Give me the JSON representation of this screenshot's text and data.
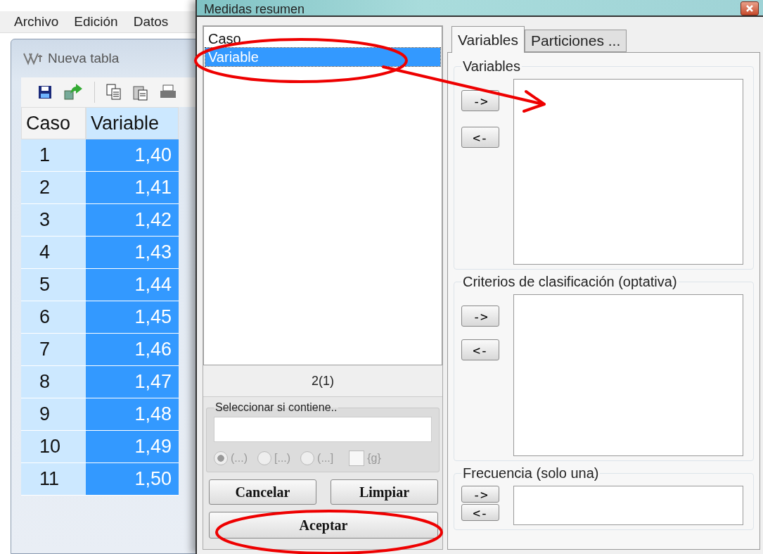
{
  "main_window": {
    "menu": [
      "Archivo",
      "Edición",
      "Datos"
    ],
    "table_window": {
      "title": "Nueva tabla"
    },
    "table": {
      "columns": [
        {
          "label": "Caso",
          "selected": false
        },
        {
          "label": "Variable",
          "selected": true
        }
      ],
      "rows": [
        [
          "1",
          "1,40"
        ],
        [
          "2",
          "1,41"
        ],
        [
          "3",
          "1,42"
        ],
        [
          "4",
          "1,43"
        ],
        [
          "5",
          "1,44"
        ],
        [
          "6",
          "1,45"
        ],
        [
          "7",
          "1,46"
        ],
        [
          "8",
          "1,47"
        ],
        [
          "9",
          "1,48"
        ],
        [
          "10",
          "1,49"
        ],
        [
          "11",
          "1,50"
        ]
      ]
    }
  },
  "dialog": {
    "title": "Medidas resumen",
    "variable_list": [
      {
        "label": "Caso",
        "selected": false
      },
      {
        "label": "Variable",
        "selected": true
      }
    ],
    "count": "2(1)",
    "filter": {
      "title": "Seleccionar si contiene..",
      "options": [
        {
          "kind": "radio",
          "label": "(...)",
          "selected": true
        },
        {
          "kind": "radio",
          "label": "[...)",
          "selected": false
        },
        {
          "kind": "radio",
          "label": "(...]",
          "selected": false
        },
        {
          "kind": "checkbox",
          "label": "{g}",
          "checked": false
        }
      ]
    },
    "buttons": [
      "Cancelar",
      "Limpiar",
      "Aceptar"
    ],
    "tabs": [
      {
        "label": "Variables",
        "selected": true
      },
      {
        "label": "Particiones ...",
        "selected": false
      }
    ],
    "groups": [
      {
        "title": "Variables",
        "kind": "large",
        "add": "->",
        "remove": "<-"
      },
      {
        "title": "Criterios de clasificación (optativa)",
        "kind": "medium",
        "add": "->",
        "remove": "<-"
      },
      {
        "title": "Frecuencia (solo una)",
        "kind": "small",
        "add": "->",
        "remove": "<-"
      }
    ]
  }
}
